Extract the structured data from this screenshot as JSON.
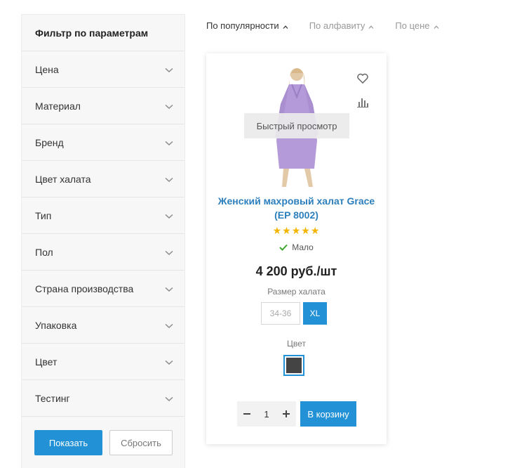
{
  "filter": {
    "title": "Фильтр по параметрам",
    "items": [
      {
        "label": "Цена"
      },
      {
        "label": "Материал"
      },
      {
        "label": "Бренд"
      },
      {
        "label": "Цвет халата"
      },
      {
        "label": "Тип"
      },
      {
        "label": "Пол"
      },
      {
        "label": "Страна производства"
      },
      {
        "label": "Упаковка"
      },
      {
        "label": "Цвет"
      },
      {
        "label": "Тестинг"
      }
    ],
    "show_label": "Показать",
    "reset_label": "Сбросить"
  },
  "sort": {
    "items": [
      {
        "label": "По популярности",
        "active": true
      },
      {
        "label": "По алфавиту",
        "active": false
      },
      {
        "label": "По цене",
        "active": false
      }
    ]
  },
  "product": {
    "quick_view_label": "Быстрый просмотр",
    "name": "Женский махровый халат Grace (EP 8002)",
    "rating": 5,
    "stock_label": "Мало",
    "price": "4 200 руб./шт",
    "size_label": "Размер халата",
    "sizes": [
      {
        "label": "34-36",
        "selected": false
      },
      {
        "label": "XL",
        "selected": true
      }
    ],
    "color_label": "Цвет",
    "swatch_color": "#444444",
    "quantity": "1",
    "cart_label": "В корзину",
    "icons": [
      "heart-icon",
      "bar-chart-icon",
      "check-icon",
      "minus-icon",
      "plus-icon"
    ]
  },
  "colors": {
    "accent": "#2291d6",
    "link": "#2c7fbd",
    "star": "#f5b400",
    "stock_ok": "#3ea82f",
    "robe": "#b49ad8"
  }
}
